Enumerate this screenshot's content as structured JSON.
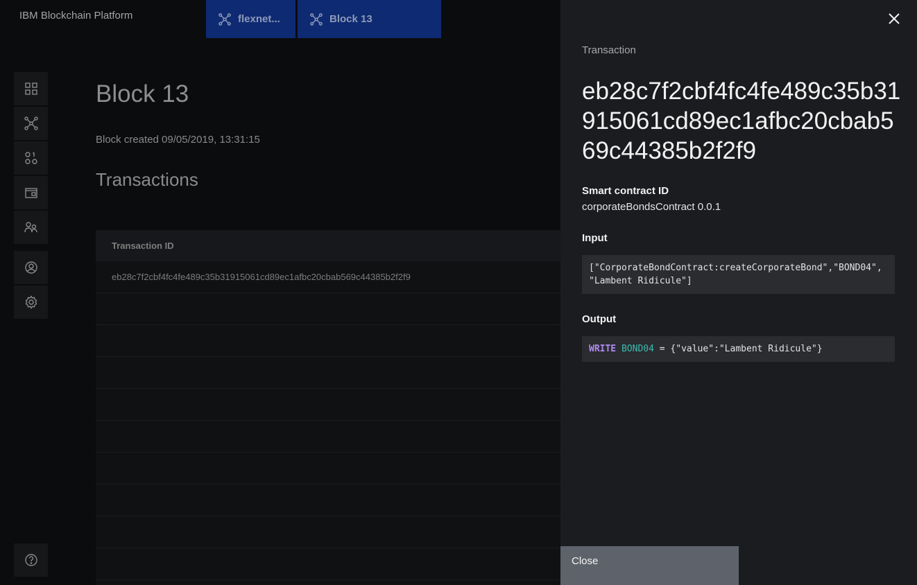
{
  "app": {
    "brand": "IBM Blockchain Platform"
  },
  "tabs": [
    {
      "label": "flexnet...",
      "icon": "network-icon"
    },
    {
      "label": "Block 13",
      "icon": "network-icon"
    }
  ],
  "sidenav": {
    "items": [
      "dashboard-icon",
      "network-icon",
      "smart-contracts-icon",
      "wallet-icon",
      "users-icon",
      "user-profile-icon",
      "settings-icon",
      "help-icon"
    ]
  },
  "page": {
    "title": "Block 13",
    "subtitle": "Block created 09/05/2019, 13:31:15",
    "section_title": "Transactions",
    "table": {
      "header": "Transaction ID",
      "rows": [
        "eb28c7f2cbf4fc4fe489c35b31915061cd89ec1afbc20cbab569c44385b2f2f9"
      ]
    }
  },
  "panel": {
    "label": "Transaction",
    "hash": "eb28c7f2cbf4fc4fe489c35b31915061cd89ec1afbc20cbab569c44385b2f2f9",
    "contract_heading": "Smart contract ID",
    "contract_value": "corporateBondsContract 0.0.1",
    "input_heading": "Input",
    "input_value": "[\"CorporateBondContract:createCorporateBond\",\"BOND04\", \"Lambent Ridicule\"]",
    "output_heading": "Output",
    "output": {
      "keyword": "WRITE",
      "key": "BOND04",
      "rest": " = {\"value\":\"Lambent Ridicule\"}"
    },
    "close_button": "Close"
  },
  "colors": {
    "panel_bg": "#1a1c1f",
    "tab_bg": "#0e2a72",
    "keyword": "#b08bf0",
    "ident": "#3bbbb0",
    "close_btn": "#5e636b"
  }
}
